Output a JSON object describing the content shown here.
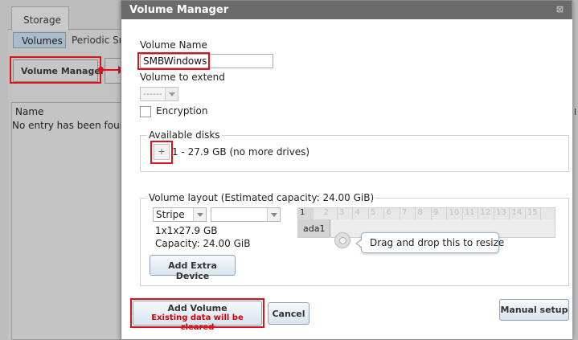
{
  "background": {
    "tab_storage": "Storage",
    "subtab_volumes": "Volumes",
    "subtab_periodic": "Periodic Sn",
    "volume_manager_button": "Volume Manager",
    "table_col_name": "Name",
    "table_empty": "No entry has been found",
    "right_col_letter": "I"
  },
  "dialog": {
    "title": "Volume Manager",
    "close_glyph": "⊠",
    "volume_name_label": "Volume Name",
    "volume_name_value": "SMBWindows",
    "volume_to_extend_label": "Volume to extend",
    "volume_to_extend_value": "------",
    "encryption_label": "Encryption",
    "available_disks_legend": "Available disks",
    "plus_glyph": "+",
    "disk_summary": "1 - 27.9 GB (no more drives)",
    "layout_legend": "Volume layout (Estimated capacity: 24.00 GiB)",
    "layout_type": "Stripe",
    "layout_size_value": "",
    "layout_config": "1x1x27.9 GB",
    "capacity": "Capacity: 24.00 GiB",
    "add_extra_device": "Add Extra Device",
    "grid_columns": [
      "1",
      "2",
      "3",
      "4",
      "5",
      "6",
      "7",
      "8",
      "9",
      "10",
      "11",
      "12",
      "13",
      "14",
      "15"
    ],
    "grid_drive": "ada1",
    "tooltip": "Drag and drop this to resize",
    "add_volume_label": "Add Volume",
    "add_volume_warning": "Existing data will be cleared",
    "cancel_label": "Cancel",
    "manual_setup_label": "Manual setup"
  },
  "colors": {
    "highlight": "#e0101a",
    "titlebar": "#6b6b6b",
    "warning_text": "#d40000"
  }
}
